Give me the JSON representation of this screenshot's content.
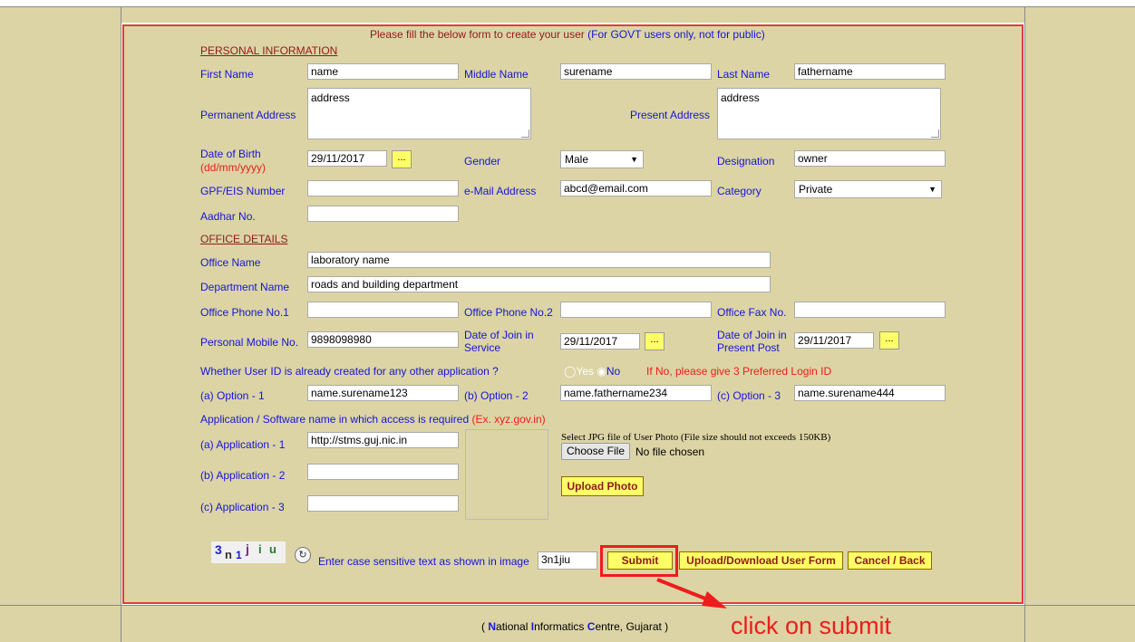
{
  "form": {
    "intro_black": "Please fill the below form to create your user",
    "intro_blue": "(For GOVT users only, not for public)",
    "personal_section": "PERSONAL INFORMATION",
    "office_section": "OFFICE DETAILS",
    "first_name_label": "First Name",
    "first_name_value": "name",
    "middle_name_label": "Middle Name",
    "middle_name_value": "surename",
    "last_name_label": "Last Name",
    "last_name_value": "fathername",
    "perm_address_label": "Permanent Address",
    "perm_address_value": "address",
    "present_address_label": "Present Address",
    "present_address_value": "address",
    "dob_label": "Date of Birth",
    "dob_hint": "(dd/mm/yyyy)",
    "dob_value": "29/11/2017",
    "dots": "...",
    "gender_label": "Gender",
    "gender_value": "Male",
    "designation_label": "Designation",
    "designation_value": "owner",
    "gpf_label": "GPF/EIS Number",
    "gpf_value": "",
    "email_label": "e-Mail Address",
    "email_value": "abcd@email.com",
    "category_label": "Category",
    "category_value": "Private",
    "aadhar_label": "Aadhar No.",
    "aadhar_value": "",
    "office_name_label": "Office Name",
    "office_name_value": "laboratory name",
    "dept_label": "Department Name",
    "dept_value": "roads and building department",
    "phone1_label": "Office Phone No.1",
    "phone1_value": "",
    "phone2_label": "Office Phone No.2",
    "phone2_value": "",
    "fax_label": "Office Fax No.",
    "fax_value": "",
    "mobile_label": "Personal Mobile No.",
    "mobile_value": "9898098980",
    "join_service_label_1": "Date of Join in",
    "join_service_label_2": "Service",
    "join_service_value": "29/11/2017",
    "join_post_label_1": "Date of Join in",
    "join_post_label_2": "Present Post",
    "join_post_value": "29/11/2017",
    "userid_question": "Whether User ID is already created for any other application ?",
    "yes_label": "Yes",
    "no_label": "No",
    "userid_note": "If No, please give 3 Preferred Login ID",
    "opt1_label": "(a) Option - 1",
    "opt1_value": "name.surename123",
    "opt2_label": "(b) Option - 2",
    "opt2_value": "name.fathername234",
    "opt3_label": "(c) Option - 3",
    "opt3_value": "name.surename444",
    "app_question": "Application / Software name in which access is required",
    "app_example": "(Ex. xyz.gov.in)",
    "app1_label": "(a) Application - 1",
    "app1_value": "http://stms.guj.nic.in",
    "app2_label": "(b) Application - 2",
    "app2_value": "",
    "app3_label": "(c) Application - 3",
    "app3_value": "",
    "photo_note": "Select JPG file of User Photo (File size should not exceeds 150KB)",
    "choose_file": "Choose File",
    "no_file": "No file chosen",
    "upload_photo": "Upload Photo",
    "captcha_text": "Enter case sensitive text as shown in image",
    "captcha_value": "3n1jiu",
    "submit": "Submit",
    "upload_download": "Upload/Download User Form",
    "cancel_back": "Cancel / Back"
  },
  "captcha_image": {
    "c1": "3",
    "c2": "n",
    "c3": "1",
    "c4": "j",
    "c5": "i",
    "c6": "u"
  },
  "footer": {
    "open": "(",
    "n": "N",
    "ational": "ational",
    "i": "I",
    "nformatics": "nformatics",
    "c": "C",
    "entre": "entre, Gujarat",
    "close": ")"
  },
  "annotation": {
    "text": "click on submit"
  },
  "colors": {
    "band": "#dcd4a4",
    "label_blue": "#1515d8",
    "red": "#ee1c1c",
    "button_yellow": "#ffff66",
    "section_maroon": "#8b1c1c",
    "annotation_red": "#ee1c1c"
  }
}
